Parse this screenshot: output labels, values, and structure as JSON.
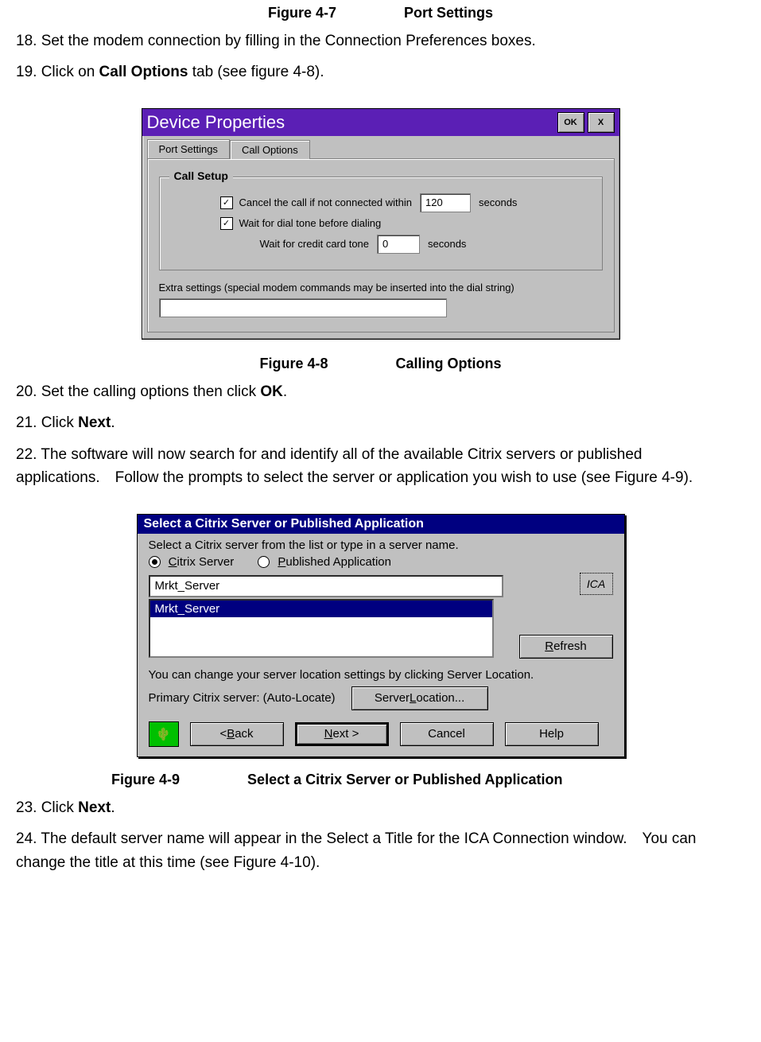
{
  "caption47": {
    "fig": "Figure 4-7",
    "title": "Port Settings"
  },
  "step18": "18. Set the modem connection by filling in the Connection Preferences boxes.",
  "step19_pre": "19. Click on ",
  "step19_bold": "Call Options",
  "step19_post": " tab (see figure 4-8).",
  "dlg48": {
    "title": "Device Properties",
    "ok": "OK",
    "close": "X",
    "tab_port": "Port Settings",
    "tab_call": "Call Options",
    "group": "Call Setup",
    "chk1_label": "Cancel the call if not connected within",
    "chk1_value": "120",
    "chk1_unit": "seconds",
    "chk2_label": "Wait for dial tone before dialing",
    "credit_label": "Wait for credit card tone",
    "credit_value": "0",
    "credit_unit": "seconds",
    "extra": "Extra settings (special modem commands may be inserted into the dial string)"
  },
  "caption48": {
    "fig": "Figure 4-8",
    "title": "Calling Options"
  },
  "step20_pre": "20. Set the calling options then click ",
  "step20_bold": "OK",
  "step20_post": ".",
  "step21_pre": "21. Click ",
  "step21_bold": "Next",
  "step21_post": ".",
  "step22": "22. The software will now search for and identify all of the available Citrix servers or published applications. Follow the prompts to select the server or application you wish to use (see Figure 4-9).",
  "dlg49": {
    "title": "Select a Citrix Server or Published Application",
    "instr": "Select a Citrix server from the list or type in a server name.",
    "radio_server_pre": "C",
    "radio_server_post": "itrix Server",
    "radio_pub_pre": "P",
    "radio_pub_post": "ublished Application",
    "server_name": "Mrkt_Server",
    "list_item": "Mrkt_Server",
    "refresh_pre": "R",
    "refresh_post": "efresh",
    "change_text": "You can change your server location settings by clicking Server Location.",
    "primary": "Primary Citrix server: (Auto-Locate)",
    "srvloc_pre1": "Server ",
    "srvloc_u": "L",
    "srvloc_post": "ocation...",
    "back_pre": "< ",
    "back_u": "B",
    "back_post": "ack",
    "next_u": "N",
    "next_post": "ext >",
    "cancel": "Cancel",
    "help": "Help",
    "ica": "ICA"
  },
  "caption49": {
    "fig": "Figure 4-9",
    "title": "Select a Citrix Server or Published Application"
  },
  "step23_pre": "23. Click ",
  "step23_bold": "Next",
  "step23_post": ".",
  "step24": "24. The default server name will appear in the Select a Title for the ICA Connection window. You can change the title at this time (see Figure 4-10)."
}
